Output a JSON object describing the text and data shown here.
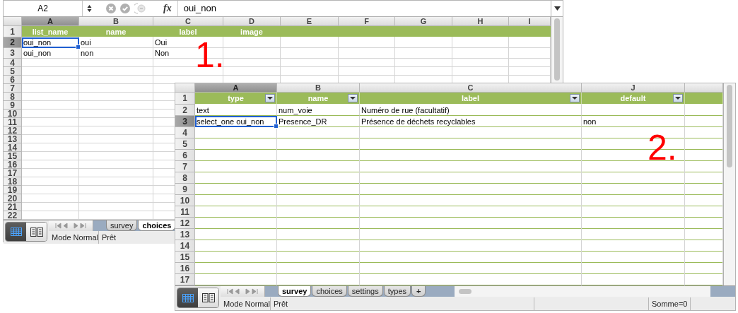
{
  "windows": [
    {
      "formula_bar": {
        "cell_ref": "A2",
        "function_label": "fx",
        "formula": "oui_non"
      },
      "filter_buttons": false,
      "columns": [
        {
          "letter": "A",
          "selected": true
        },
        {
          "letter": "B",
          "selected": false
        },
        {
          "letter": "C",
          "selected": false
        },
        {
          "letter": "D",
          "selected": false
        },
        {
          "letter": "E",
          "selected": false
        },
        {
          "letter": "F",
          "selected": false
        },
        {
          "letter": "G",
          "selected": false
        },
        {
          "letter": "H",
          "selected": false
        },
        {
          "letter": "I",
          "selected": false
        }
      ],
      "rows": [
        {
          "number": "1",
          "kind": "header",
          "selected": false,
          "cells": [
            "list_name",
            "name",
            "label",
            "image"
          ]
        },
        {
          "number": "2",
          "kind": "data",
          "selected": true,
          "cells": [
            "oui_non",
            "oui",
            "Oui"
          ]
        },
        {
          "number": "3",
          "kind": "data",
          "selected": false,
          "cells": [
            "oui_non",
            "non",
            "Non"
          ]
        },
        {
          "number": "4",
          "kind": "data",
          "selected": false
        },
        {
          "number": "5",
          "kind": "data",
          "selected": false
        },
        {
          "number": "6",
          "kind": "data",
          "selected": false
        },
        {
          "number": "7",
          "kind": "data",
          "selected": false
        },
        {
          "number": "8",
          "kind": "data",
          "selected": false
        },
        {
          "number": "9",
          "kind": "data",
          "selected": false
        },
        {
          "number": "10",
          "kind": "data",
          "selected": false
        },
        {
          "number": "11",
          "kind": "data",
          "selected": false
        },
        {
          "number": "12",
          "kind": "data",
          "selected": false
        },
        {
          "number": "13",
          "kind": "data",
          "selected": false
        },
        {
          "number": "14",
          "kind": "data",
          "selected": false
        },
        {
          "number": "15",
          "kind": "data",
          "selected": false
        },
        {
          "number": "16",
          "kind": "data",
          "selected": false
        },
        {
          "number": "17",
          "kind": "data",
          "selected": false
        },
        {
          "number": "18",
          "kind": "data",
          "selected": false
        },
        {
          "number": "19",
          "kind": "data",
          "selected": false
        },
        {
          "number": "20",
          "kind": "data",
          "selected": false
        },
        {
          "number": "21",
          "kind": "data",
          "selected": false
        },
        {
          "number": "22",
          "kind": "data",
          "selected": false
        }
      ],
      "view_buttons": [
        {
          "selected": true
        },
        {
          "selected": false
        }
      ],
      "sheet_tabs": [
        {
          "label": "survey",
          "selected": false
        },
        {
          "label": "choices",
          "selected": true
        }
      ],
      "status_bar": {
        "mode": "Mode Normal",
        "state": "Prêt"
      },
      "annotation": "1."
    },
    {
      "filter_buttons": true,
      "columns": [
        {
          "letter": "A",
          "selected": true
        },
        {
          "letter": "B",
          "selected": false
        },
        {
          "letter": "C",
          "selected": false
        },
        {
          "letter": "J",
          "selected": false
        }
      ],
      "rows": [
        {
          "number": "1",
          "kind": "header",
          "selected": false,
          "cells": [
            "type",
            "name",
            "label",
            "default"
          ]
        },
        {
          "number": "2",
          "kind": "data",
          "selected": false,
          "cells": [
            "text",
            "num_voie",
            "Numéro de rue (facultatif)"
          ]
        },
        {
          "number": "3",
          "kind": "data",
          "selected": true,
          "cells": [
            "select_one oui_non",
            "Presence_DR",
            "Présence de déchets recyclables",
            "non"
          ]
        },
        {
          "number": "4",
          "kind": "data",
          "selected": false
        },
        {
          "number": "5",
          "kind": "data",
          "selected": false
        },
        {
          "number": "6",
          "kind": "data",
          "selected": false
        },
        {
          "number": "7",
          "kind": "data",
          "selected": false
        },
        {
          "number": "8",
          "kind": "data",
          "selected": false
        },
        {
          "number": "9",
          "kind": "data",
          "selected": false
        },
        {
          "number": "10",
          "kind": "data",
          "selected": false
        },
        {
          "number": "11",
          "kind": "data",
          "selected": false
        },
        {
          "number": "12",
          "kind": "data",
          "selected": false
        },
        {
          "number": "13",
          "kind": "data",
          "selected": false
        },
        {
          "number": "14",
          "kind": "data",
          "selected": false
        },
        {
          "number": "15",
          "kind": "data",
          "selected": false
        },
        {
          "number": "16",
          "kind": "data",
          "selected": false
        },
        {
          "number": "17",
          "kind": "data",
          "selected": false
        }
      ],
      "view_buttons": [
        {
          "selected": true
        },
        {
          "selected": false
        }
      ],
      "sheet_tabs": [
        {
          "label": "survey",
          "selected": true
        },
        {
          "label": "choices",
          "selected": false
        },
        {
          "label": "settings",
          "selected": false
        },
        {
          "label": "types",
          "selected": false
        }
      ],
      "add_tab": "+",
      "status_bar": {
        "mode": "Mode Normal",
        "state": "Prêt",
        "sum": "Somme=0"
      },
      "annotation": "2."
    }
  ]
}
